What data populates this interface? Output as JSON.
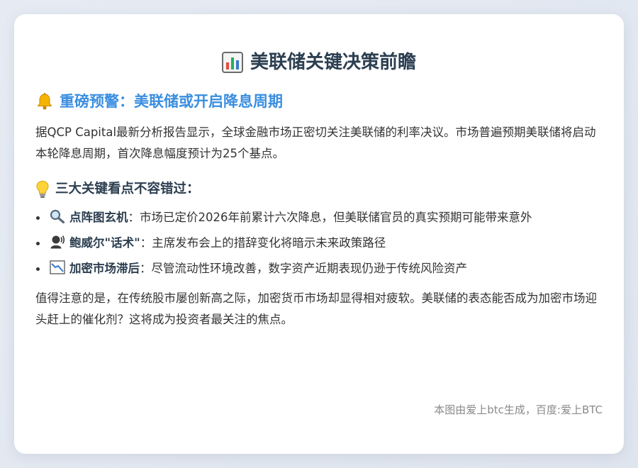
{
  "card": {
    "title": "美联储关键决策前瞻",
    "title_icon": "bar-chart-icon",
    "alert_heading": "重磅预警：美联储或开启降息周期",
    "alert_icon": "bell-icon",
    "intro": "据QCP Capital最新分析报告显示，全球金融市场正密切关注美联储的利率决议。市场普遍预期美联储将启动本轮降息周期，首次降息幅度预计为25个基点。",
    "points_heading": "三大关键看点不容错过：",
    "points_icon": "lightbulb-icon",
    "points": [
      {
        "icon": "magnifier-icon",
        "title": "点阵图玄机",
        "separator": "：",
        "text": "市场已定价2026年前累计六次降息，但美联储官员的真实预期可能带来意外"
      },
      {
        "icon": "speaker-person-icon",
        "title": "鲍威尔\"话术\"",
        "separator": "：",
        "text": "主席发布会上的措辞变化将暗示未来政策路径"
      },
      {
        "icon": "chart-decreasing-icon",
        "title": "加密市场滞后",
        "separator": "：",
        "text": "尽管流动性环境改善，数字资产近期表现仍逊于传统风险资产"
      }
    ],
    "conclusion": "值得注意的是，在传统股市屡创新高之际，加密货币市场却显得相对疲软。美联储的表态能否成为加密市场迎头赶上的催化剂？这将成为投资者最关注的焦点。",
    "footer": "本图由爱上btc生成，百度:爱上BTC"
  },
  "colors": {
    "accent": "#3a8ee0",
    "heading": "#2c3e50",
    "text": "#333333",
    "muted": "#8a8a8a",
    "background": "#e3e8f1",
    "card": "#ffffff"
  }
}
